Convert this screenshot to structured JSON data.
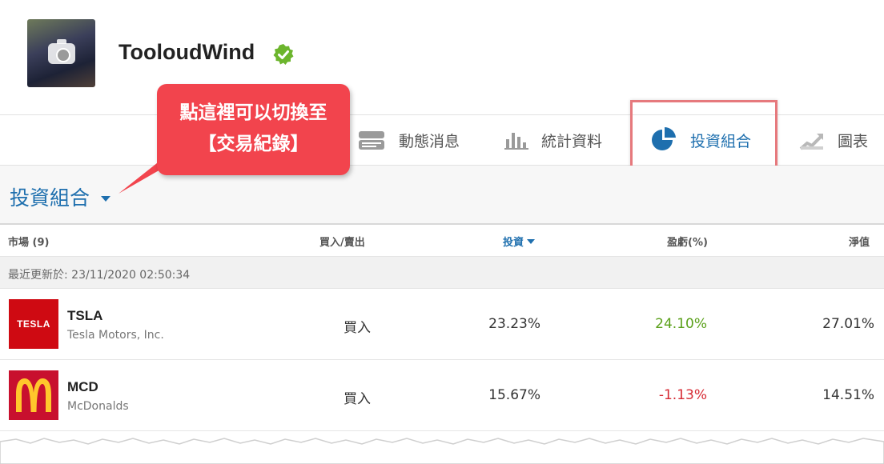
{
  "profile": {
    "username": "TooloudWind",
    "verified_icon": "verified-check-icon"
  },
  "nav": {
    "tabs": [
      {
        "label": "動態消息",
        "icon": "feed-icon",
        "active": false
      },
      {
        "label": "統計資料",
        "icon": "bar-chart-icon",
        "active": false
      },
      {
        "label": "投資組合",
        "icon": "pie-chart-icon",
        "active": true
      },
      {
        "label": "圖表",
        "icon": "trend-chart-icon",
        "active": false
      }
    ]
  },
  "callout": {
    "line1": "點這裡可以切換至",
    "line2": "【交易紀錄】"
  },
  "section": {
    "title": "投資組合"
  },
  "table": {
    "headers": {
      "market": "市場 (9)",
      "side": "買入/賣出",
      "invest": "投資",
      "pl": "盈虧(%)",
      "net": "淨值"
    },
    "updated": "最近更新於: 23/11/2020 02:50:34",
    "rows": [
      {
        "ticker": "TSLA",
        "company": "Tesla Motors, Inc.",
        "logo_text": "TESLA",
        "side": "買入",
        "invest": "23.23%",
        "pl": "24.10%",
        "net": "27.01%"
      },
      {
        "ticker": "MCD",
        "company": "McDonalds",
        "logo_text": "",
        "side": "買入",
        "invest": "15.67%",
        "pl": "-1.13%",
        "net": "14.51%"
      }
    ]
  },
  "colors": {
    "accent": "#1e6fae",
    "positive": "#5aa01a",
    "negative": "#d62a33",
    "callout": "#f2444d",
    "highlight": "#e6797d"
  }
}
